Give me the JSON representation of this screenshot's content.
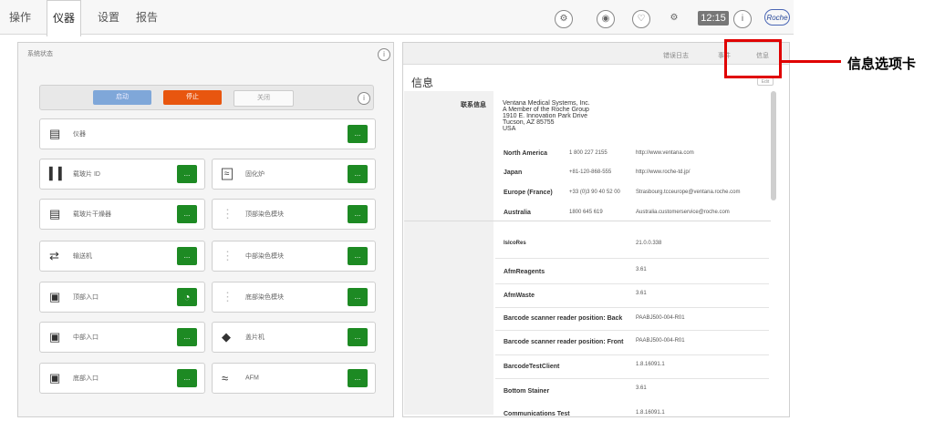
{
  "top_tabs": [
    "操作",
    "仪器",
    "设置",
    "报告"
  ],
  "status": {
    "clock": "12:15",
    "brand": "Roche"
  },
  "left_panel": {
    "title": "系统状态",
    "controls": [
      "启动",
      "停止",
      "关闭"
    ],
    "instrument_label": "仪器",
    "modules_left": [
      "载玻片 ID",
      "载玻片干燥器",
      "输送机",
      "顶部入口",
      "中部入口",
      "底部入口"
    ],
    "modules_right": [
      "固化炉",
      "顶部染色模块",
      "中部染色模块",
      "底部染色模块",
      "盖片机",
      "AFM"
    ],
    "button_glyph": "..."
  },
  "right_panel": {
    "tabs": [
      "错误日志",
      "事件",
      "信息"
    ],
    "heading": "信息",
    "edit_label": "Edit",
    "contact_label": "联系信息",
    "address": [
      "Ventana Medical Systems, Inc.",
      "A Member of the Roche Group",
      "1910 E. Innovation Park Drive",
      "Tucson, AZ 85755",
      "USA"
    ],
    "contacts": [
      {
        "region": "North America",
        "phone": "1 800 227 2155",
        "url": "http://www.ventana.com"
      },
      {
        "region": "Japan",
        "phone": "+81-120-868-555",
        "url": "http://www.roche-td.jp/"
      },
      {
        "region": "Europe (France)",
        "phone": "+33 (0)3 90 40 52 00",
        "url": "Strasbourg.tcceurope@ventana.roche.com"
      },
      {
        "region": "Australia",
        "phone": "1800 645 619",
        "url": "Australia.customerservice@roche.com"
      }
    ],
    "versions": [
      {
        "name": "IslcoRes",
        "value": "21.0.0.338"
      },
      {
        "name": "AfmReagents",
        "value": "3.61"
      },
      {
        "name": "AfmWaste",
        "value": "3.61"
      },
      {
        "name": "Barcode scanner reader position: Back",
        "value": "PAABJ500-004-R01"
      },
      {
        "name": "Barcode scanner reader position: Front",
        "value": "PAABJ500-004-R01"
      },
      {
        "name": "BarcodeTestClient",
        "value": "1.8.16091.1"
      },
      {
        "name": "Bottom Stainer",
        "value": "3.61"
      },
      {
        "name": "Communications Test",
        "value": "1.8.16091.1"
      }
    ]
  },
  "callout": "信息选项卡",
  "colors": {
    "accent_green": "#1d8a23",
    "stop_orange": "#e8560f",
    "start_blue": "#7fa7d9",
    "highlight_red": "#e00000"
  }
}
